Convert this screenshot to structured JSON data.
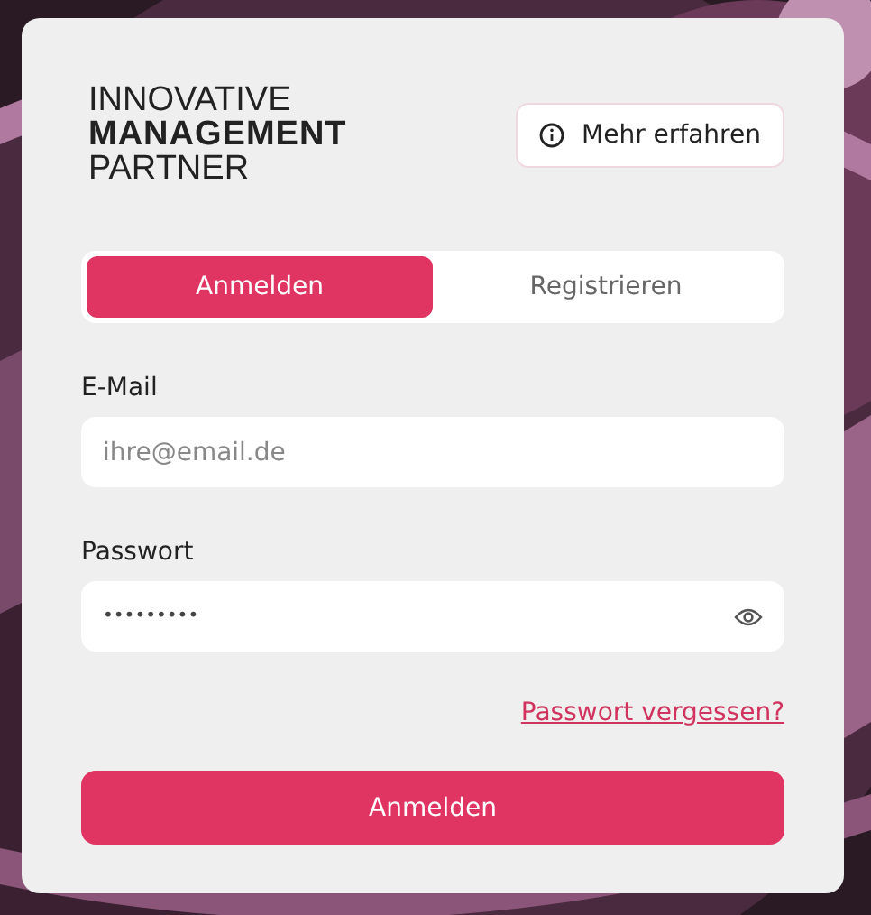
{
  "logo": {
    "lines": [
      "INNOVATIVE",
      "MANAGEMENT",
      "PARTNER"
    ]
  },
  "info_button": {
    "label": "Mehr erfahren"
  },
  "tabs": [
    {
      "label": "Anmelden",
      "selected": true
    },
    {
      "label": "Registrieren",
      "selected": false
    }
  ],
  "email": {
    "label": "E-Mail",
    "placeholder": "ihre@email.de"
  },
  "password": {
    "label": "Passwort",
    "value": "•••••••••"
  },
  "forgot_link": "Passwort vergessen?",
  "submit": {
    "label": "Anmelden"
  }
}
